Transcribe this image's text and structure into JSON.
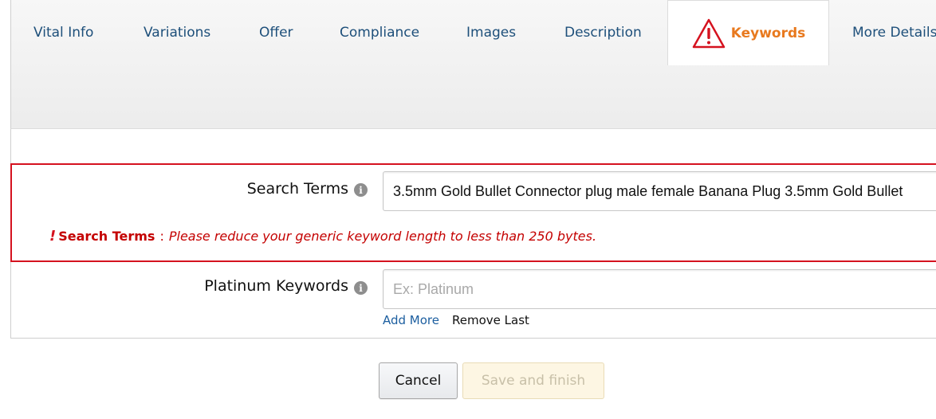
{
  "tabs": [
    {
      "label": "Vital Info"
    },
    {
      "label": "Variations"
    },
    {
      "label": "Offer"
    },
    {
      "label": "Compliance"
    },
    {
      "label": "Images"
    },
    {
      "label": "Description"
    },
    {
      "label": "Keywords",
      "active": true,
      "icon": "warning-triangle-icon"
    },
    {
      "label": "More Details"
    }
  ],
  "search_terms": {
    "label": "Search Terms",
    "info_icon": "i",
    "value": "3.5mm Gold Bullet Connector plug male female Banana Plug 3.5mm Gold Bullet"
  },
  "error": {
    "mark": "!",
    "field": "Search Terms",
    "separator": ":",
    "message": "Please reduce your generic keyword length to less than 250 bytes."
  },
  "platinum_keywords": {
    "label": "Platinum Keywords",
    "info_icon": "i",
    "placeholder": "Ex: Platinum",
    "value": ""
  },
  "links": {
    "add_more": "Add More",
    "remove_last": "Remove Last"
  },
  "buttons": {
    "cancel": "Cancel",
    "save_finish": "Save and finish"
  },
  "colors": {
    "accent_orange": "#e8791e",
    "error_red": "#d5121f",
    "link_blue": "#1d4f7a"
  }
}
